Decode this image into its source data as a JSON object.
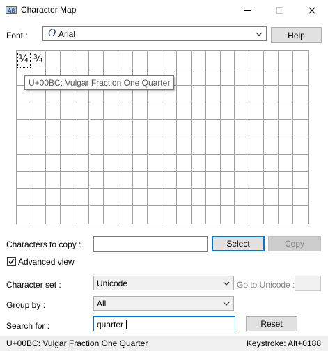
{
  "window": {
    "title": "Character Map",
    "minimize_icon": "minimize-icon",
    "maximize_icon": "maximize-icon",
    "close_icon": "close-icon"
  },
  "font": {
    "label": "Font :",
    "selected": "Arial",
    "font_type_glyph": "O",
    "help_label": "Help"
  },
  "grid": {
    "characters": [
      "¼",
      "¾"
    ],
    "tooltip": "U+00BC: Vulgar Fraction One Quarter"
  },
  "copy": {
    "label": "Characters to copy :",
    "value": "",
    "select_label": "Select",
    "copy_label": "Copy"
  },
  "advanced": {
    "label": "Advanced view",
    "checked": true
  },
  "charset": {
    "label": "Character set :",
    "selected": "Unicode",
    "goto_label": "Go to Unicode :",
    "goto_value": ""
  },
  "groupby": {
    "label": "Group by :",
    "selected": "All"
  },
  "search": {
    "label": "Search for :",
    "value": "quarter",
    "reset_label": "Reset"
  },
  "status": {
    "left": "U+00BC: Vulgar Fraction One Quarter",
    "right": "Keystroke: Alt+0188"
  },
  "colors": {
    "accent": "#0078d7",
    "disabled_text": "#838383"
  }
}
